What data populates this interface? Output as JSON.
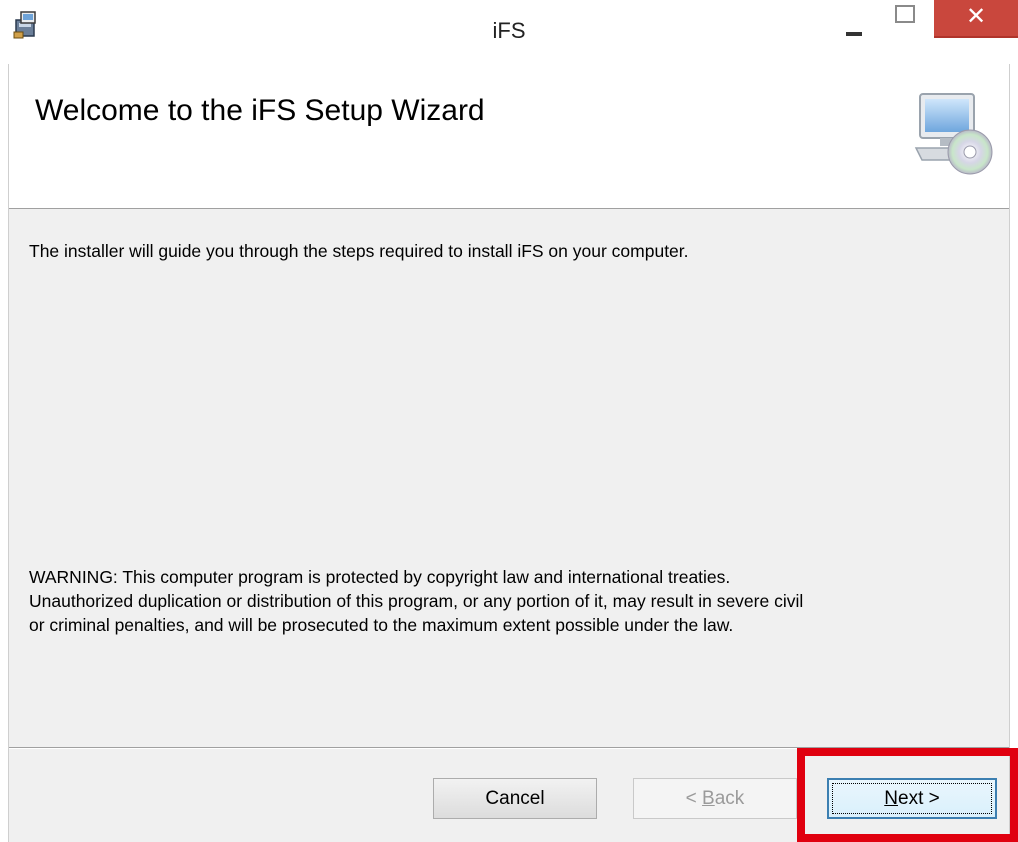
{
  "window": {
    "title": "iFS",
    "close_glyph": "✕",
    "icons": {
      "app": "installer-icon",
      "minimize": "minimize-icon",
      "maximize": "maximize-icon",
      "close": "close-icon"
    }
  },
  "banner": {
    "title": "Welcome to the iFS Setup Wizard",
    "icon": "computer-cd-icon"
  },
  "content": {
    "intro": "The installer will guide you through the steps required to install iFS on your computer.",
    "warning_lines": [
      "WARNING: This computer program is protected by copyright law and international treaties.",
      "Unauthorized duplication or distribution of this program, or any portion of it, may result in severe civil",
      "or criminal penalties, and will be prosecuted to the maximum extent possible under the law."
    ]
  },
  "buttons": {
    "cancel": "Cancel",
    "back_prefix": "< ",
    "back_mnemonic": "B",
    "back_rest": "ack",
    "next_mnemonic": "N",
    "next_rest": "ext >"
  },
  "annotation": {
    "highlight_color": "#e0000f",
    "highlighted": "next-button"
  },
  "colors": {
    "dialog_bg": "#f0f0f0",
    "close_button": "#c9473d",
    "focus_border": "#3c7fb1"
  }
}
